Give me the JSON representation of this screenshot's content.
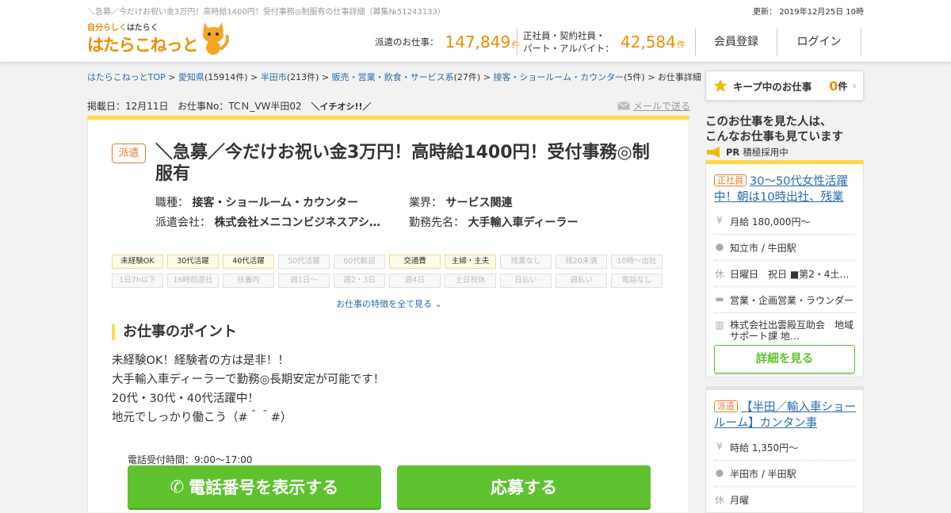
{
  "header": {
    "note": "＼急募／今だけお祝い金3万円！高時給1400円！受付事務◎制服有の仕事詳細（募集№51243133）",
    "updated_label": "更新：",
    "updated_value": "2019年12月25日 10時",
    "logo_small_a": "自分らしく",
    "logo_small_b": "はたらく",
    "logo_main": "はたらこねっと",
    "haken_label": "派遣のお仕事：",
    "haken_count": "147,849",
    "count_unit": "件",
    "seishain_label_1": "正社員・契約社員・",
    "seishain_label_2": "パート・アルバイト：",
    "seishain_count": "42,584",
    "register": "会員登録",
    "login": "ログイン"
  },
  "breadcrumb": {
    "top": "はたらこねっとTOP",
    "pref": "愛知県",
    "pref_count": "(15914件)",
    "city": "半田市",
    "city_count": "(213件)",
    "cat": "販売・営業・飲食・サービス系",
    "cat_count": "(27件)",
    "sub": "接客・ショールーム・カウンター",
    "sub_count": "(5件)",
    "current": "お仕事詳細",
    "sep": ">"
  },
  "post": {
    "date": "掲載日：12月11日",
    "job_no": "お仕事No：TCＮ_VW半田02",
    "pick": "＼イチオシ!!／",
    "mail": "メールで送る"
  },
  "job": {
    "badge": "派遣",
    "title": "＼急募／今だけお祝い金3万円！高時給1400円！受付事務◎制服有",
    "meta": [
      {
        "label": "職種：",
        "value": "接客・ショールーム・カウンター"
      },
      {
        "label": "業界：",
        "value": "サービス関連"
      },
      {
        "label": "派遣会社：",
        "value": "株式会社メニコンビジネスアシ…"
      },
      {
        "label": "勤務先名：",
        "value": "大手輸入車ディーラー"
      }
    ],
    "tags": [
      {
        "label": "未経験OK",
        "on": true
      },
      {
        "label": "30代活躍",
        "on": true
      },
      {
        "label": "40代活躍",
        "on": true
      },
      {
        "label": "50代活躍",
        "on": false
      },
      {
        "label": "60代歓迎",
        "on": false
      },
      {
        "label": "交通費",
        "on": true
      },
      {
        "label": "主婦・主夫",
        "on": true
      },
      {
        "label": "残業なし",
        "on": false
      },
      {
        "label": "残20未満",
        "on": false
      },
      {
        "label": "10時～出社",
        "on": false
      },
      {
        "label": "1日7h以下",
        "on": false
      },
      {
        "label": "16時前退社",
        "on": false
      },
      {
        "label": "扶養内",
        "on": false
      },
      {
        "label": "週1日～",
        "on": false
      },
      {
        "label": "週2・3日",
        "on": false
      },
      {
        "label": "週4日",
        "on": false
      },
      {
        "label": "土日祝休",
        "on": false
      },
      {
        "label": "日払い",
        "on": false
      },
      {
        "label": "週払い",
        "on": false
      },
      {
        "label": "電話なし",
        "on": false
      }
    ],
    "more_features": "お仕事の特徴を全て見る",
    "point_heading": "お仕事のポイント",
    "points": [
      "未経験OK！経験者の方は是非！！",
      "大手輸入車ディーラーで勤務◎長期安定が可能です！",
      "20代・30代・40代活躍中！",
      "地元でしっかり働こう（#＾＾#）"
    ],
    "tel_hours": "電話受付時間：9:00～17:00",
    "tel_button": "電話番号を表示する",
    "apply_button": "応募する"
  },
  "sidebar": {
    "keep_label": "キープ中のお仕事",
    "keep_count": "0",
    "keep_unit": "件",
    "seen_1": "このお仕事を見た人は、",
    "seen_2": "こんなお仕事も見ています",
    "pr": "PR",
    "pr_text": "積極採用中",
    "rec1": {
      "badge": "正社員",
      "title": "30～50代女性活躍中！朝は10時出社、残業",
      "salary": "月給 180,000円～",
      "location": "知立市 / 牛田駅",
      "holiday": "日曜日　祝日 ■第2・4土曜…",
      "job": "営業・企画営業・ラウンダー",
      "company": "株式会社出雲殿互助会　地域サポート課 地…",
      "detail": "詳細を見る"
    },
    "rec2": {
      "badge": "派遣",
      "title": "【半田／輸入車ショールーム】カンタン事",
      "salary": "時給 1,350円～",
      "location": "半田市 / 半田駅",
      "holiday": "月曜"
    }
  },
  "colors": {
    "accent": "#f08c00",
    "green": "#5ec22f",
    "yellow": "#ffd84a",
    "link": "#2a6bb0"
  }
}
